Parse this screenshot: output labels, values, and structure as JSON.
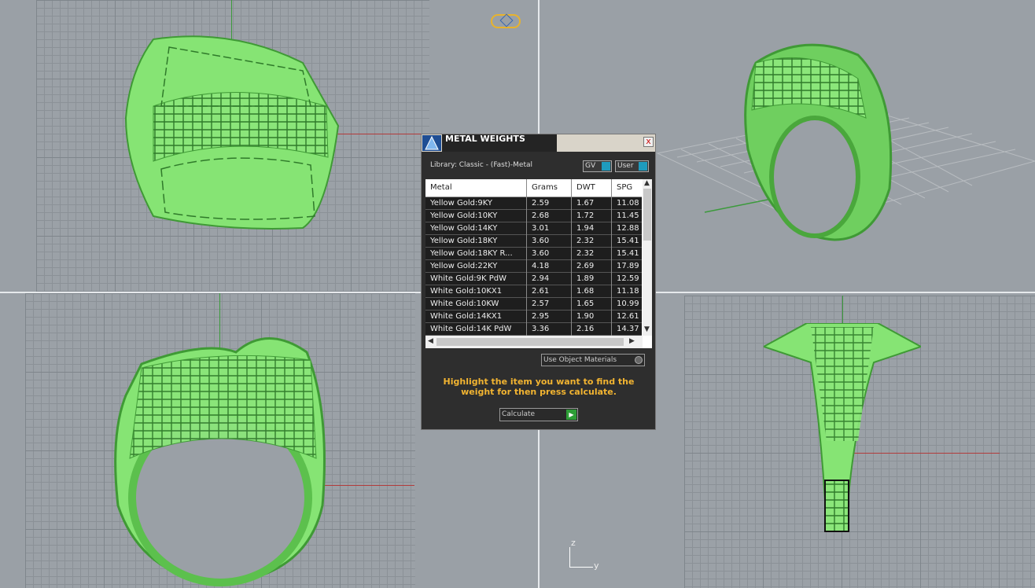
{
  "dialog": {
    "title": "METAL WEIGHTS",
    "close": "x",
    "library": "Library: Classic - (Fast)-Metal",
    "unit_select": "GV",
    "user_select": "User",
    "columns": [
      "Metal",
      "Grams",
      "DWT",
      "SPG"
    ],
    "rows": [
      [
        "Yellow Gold:9KY",
        "2.59",
        "1.67",
        "11.08"
      ],
      [
        "Yellow Gold:10KY",
        "2.68",
        "1.72",
        "11.45"
      ],
      [
        "Yellow Gold:14KY",
        "3.01",
        "1.94",
        "12.88"
      ],
      [
        "Yellow Gold:18KY",
        "3.60",
        "2.32",
        "15.41"
      ],
      [
        "Yellow Gold:18KY R...",
        "3.60",
        "2.32",
        "15.41"
      ],
      [
        "Yellow Gold:22KY",
        "4.18",
        "2.69",
        "17.89"
      ],
      [
        "White Gold:9K PdW",
        "2.94",
        "1.89",
        "12.59"
      ],
      [
        "White Gold:10KX1",
        "2.61",
        "1.68",
        "11.18"
      ],
      [
        "White Gold:10KW",
        "2.57",
        "1.65",
        "10.99"
      ],
      [
        "White Gold:14KX1",
        "2.95",
        "1.90",
        "12.61"
      ],
      [
        "White Gold:14K PdW",
        "3.36",
        "2.16",
        "14.37"
      ]
    ],
    "use_object_materials": "Use Object Materials",
    "hint": "Highlight the item you want to find the weight for then press calculate.",
    "calculate": "Calculate"
  },
  "axis": {
    "z": "z",
    "y": "y"
  },
  "colors": {
    "ring": "#7ee06c",
    "ring_dark": "#3f9a35",
    "hint": "#f2b431",
    "grid": "#9ba1a7"
  }
}
